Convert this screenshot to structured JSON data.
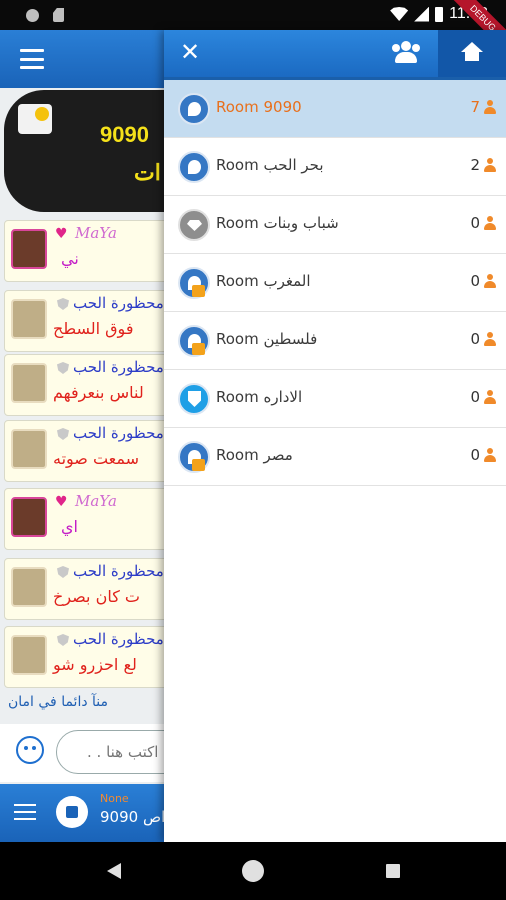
{
  "status_bar": {
    "time": "11:03",
    "ribbon": "DEBUG"
  },
  "chat": {
    "banner": {
      "line1": "9090",
      "line2": "ات"
    },
    "messages": [
      {
        "kind": "maya",
        "user": "MaYa",
        "text": "ني"
      },
      {
        "kind": "user",
        "user": "محظورة الحب",
        "text": "فوق السطح"
      },
      {
        "kind": "user",
        "user": "محظورة الحب",
        "text": "لناس بنعرفهم"
      },
      {
        "kind": "user",
        "user": "محظورة الحب",
        "text": "سمعت صوته"
      },
      {
        "kind": "maya",
        "user": "MaYa",
        "text": "اي"
      },
      {
        "kind": "user",
        "user": "محظورة الحب",
        "text": "ت كان بصرخ"
      },
      {
        "kind": "user",
        "user": "محظورة الحب",
        "text": "لع احزرو شو"
      }
    ],
    "footer_note": "منآ دائما في امان",
    "input_placeholder": ". . اكتب هنا",
    "player": {
      "label": "None",
      "room": "اص 9090"
    }
  },
  "drawer": {
    "rooms": [
      {
        "name": "Room 9090",
        "count": "7",
        "icon": "room-icon",
        "locked": false,
        "active": true
      },
      {
        "name": "Room بحر الحب",
        "count": "2",
        "icon": "room-icon",
        "locked": false,
        "active": false
      },
      {
        "name": "Room شباب وبنات",
        "count": "0",
        "icon": "diamond-icon",
        "locked": false,
        "active": false
      },
      {
        "name": "Room المغرب",
        "count": "0",
        "icon": "room-icon",
        "locked": true,
        "active": false
      },
      {
        "name": "Room فلسطين",
        "count": "0",
        "icon": "room-icon",
        "locked": true,
        "active": false
      },
      {
        "name": "Room الاداره",
        "count": "0",
        "icon": "shield-icon",
        "locked": false,
        "active": false
      },
      {
        "name": "Room مصر",
        "count": "0",
        "icon": "room-icon",
        "locked": true,
        "active": false
      }
    ]
  },
  "colors": {
    "accent": "#1b6ac2",
    "active_row": "#c4dcf0",
    "highlight": "#e8701c"
  }
}
